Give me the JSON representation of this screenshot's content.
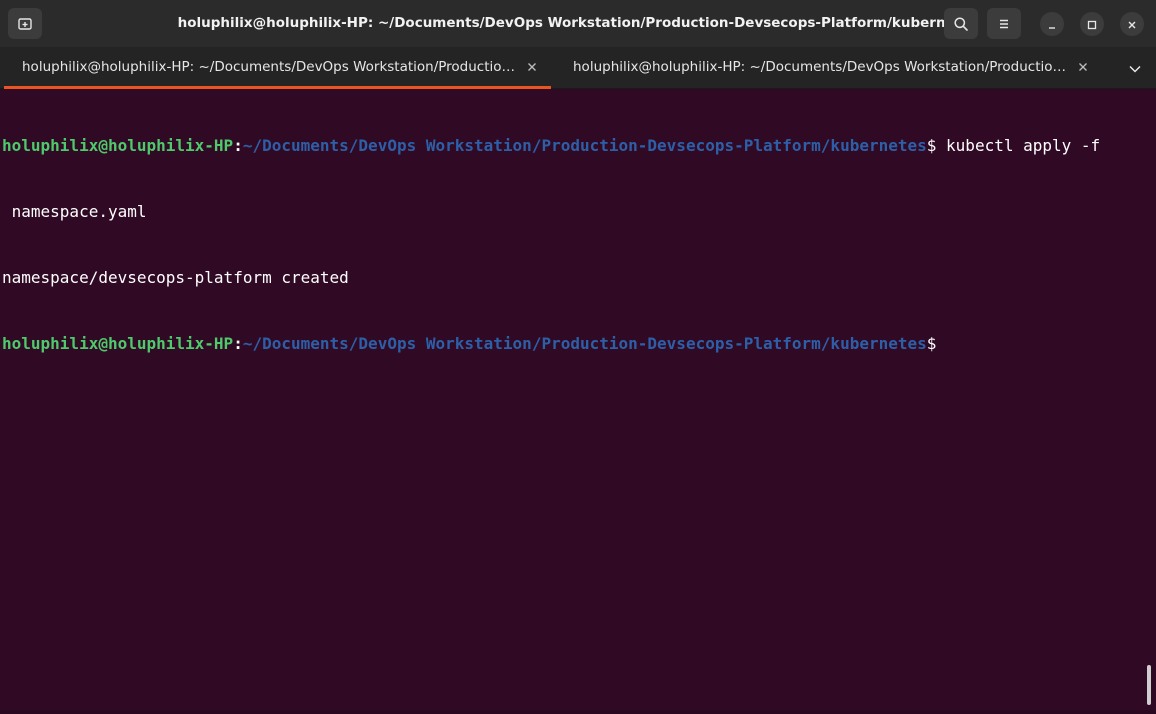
{
  "window": {
    "title": "holuphilix@holuphilix-HP: ~/Documents/DevOps Workstation/Production-Devsecops-Platform/kubernetes"
  },
  "headerbar": {
    "new_tab_icon": "new-tab-icon",
    "search_icon": "search-icon",
    "menu_icon": "hamburger-menu-icon",
    "minimize_icon": "minimize-icon",
    "maximize_icon": "maximize-icon",
    "close_icon": "close-icon"
  },
  "tabs": [
    {
      "label": "holuphilix@holuphilix-HP: ~/Documents/DevOps Workstation/Productio…",
      "active": true
    },
    {
      "label": "holuphilix@holuphilix-HP: ~/Documents/DevOps Workstation/Productio…",
      "active": false
    }
  ],
  "terminal": {
    "line1": {
      "user": "holuphilix@holuphilix-HP",
      "colon": ":",
      "path": "~/Documents/DevOps Workstation/Production-Devsecops-Platform/kubernetes",
      "dollar": "$",
      "command": " kubectl apply -f"
    },
    "line2": " namespace.yaml",
    "line3": "namespace/devsecops-platform created",
    "line4": {
      "user": "holuphilix@holuphilix-HP",
      "colon": ":",
      "path": "~/Documents/DevOps Workstation/Production-Devsecops-Platform/kubernetes",
      "dollar": "$"
    }
  },
  "colors": {
    "terminal_bg": "#300a24",
    "prompt_user": "#4ec96b",
    "prompt_path": "#2d5fa8",
    "accent": "#e95420"
  }
}
